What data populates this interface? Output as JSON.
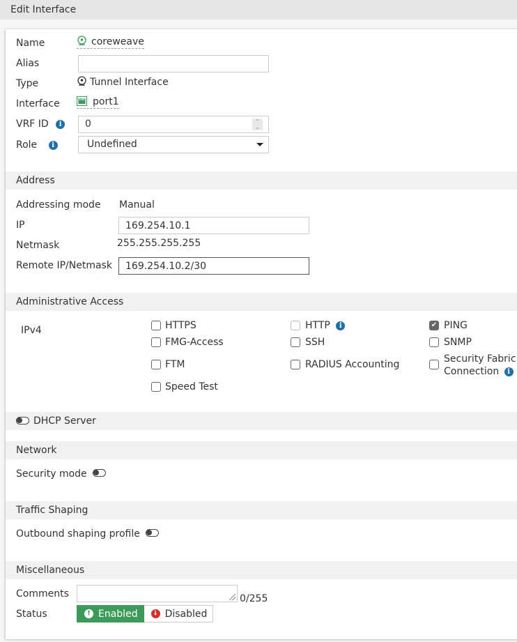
{
  "title": "Edit Interface",
  "general": {
    "name_label": "Name",
    "name_value": "coreweave",
    "name_icon": "tunnel-icon",
    "alias_label": "Alias",
    "alias_value": "",
    "type_label": "Type",
    "type_value": "Tunnel Interface",
    "type_icon": "tunnel-icon",
    "interface_label": "Interface",
    "interface_value": "port1",
    "interface_icon": "port-icon",
    "vrf_label": "VRF ID",
    "vrf_value": "0",
    "role_label": "Role",
    "role_value": "Undefined"
  },
  "address": {
    "section": "Address",
    "mode_label": "Addressing mode",
    "mode_value": "Manual",
    "ip_label": "IP",
    "ip_value": "169.254.10.1",
    "netmask_label": "Netmask",
    "netmask_value": "255.255.255.255",
    "remote_label": "Remote IP/Netmask",
    "remote_value": "169.254.10.2/30"
  },
  "admin_access": {
    "section": "Administrative Access",
    "ipv4_label": "IPv4",
    "options": [
      {
        "label": "HTTPS",
        "checked": false
      },
      {
        "label": "HTTP",
        "checked": false,
        "disabled": true
      },
      {
        "label": "PING",
        "checked": true
      },
      {
        "label": "FMG-Access",
        "checked": false
      },
      {
        "label": "SSH",
        "checked": false
      },
      {
        "label": "SNMP",
        "checked": false
      },
      {
        "label": "FTM",
        "checked": false
      },
      {
        "label": "RADIUS Accounting",
        "checked": false
      },
      {
        "label": "Security Fabric",
        "label2": "Connection",
        "checked": false
      },
      {
        "label": "Speed Test",
        "checked": false
      }
    ]
  },
  "dhcp": {
    "label": "DHCP Server",
    "enabled": false
  },
  "network": {
    "section": "Network",
    "security_mode_label": "Security mode",
    "security_mode_enabled": false
  },
  "traffic_shaping": {
    "section": "Traffic Shaping",
    "outbound_label": "Outbound shaping profile",
    "outbound_enabled": false
  },
  "misc": {
    "section": "Miscellaneous",
    "comments_label": "Comments",
    "comments_value": "",
    "comments_counter": "0/255",
    "status_label": "Status",
    "enabled_label": "Enabled",
    "disabled_label": "Disabled",
    "status_value": "Enabled"
  },
  "colors": {
    "enabled_green": "#3c9a5a",
    "disabled_red": "#d0312d",
    "info_blue": "#1f6fa8",
    "icon_green": "#3c9a5a"
  }
}
